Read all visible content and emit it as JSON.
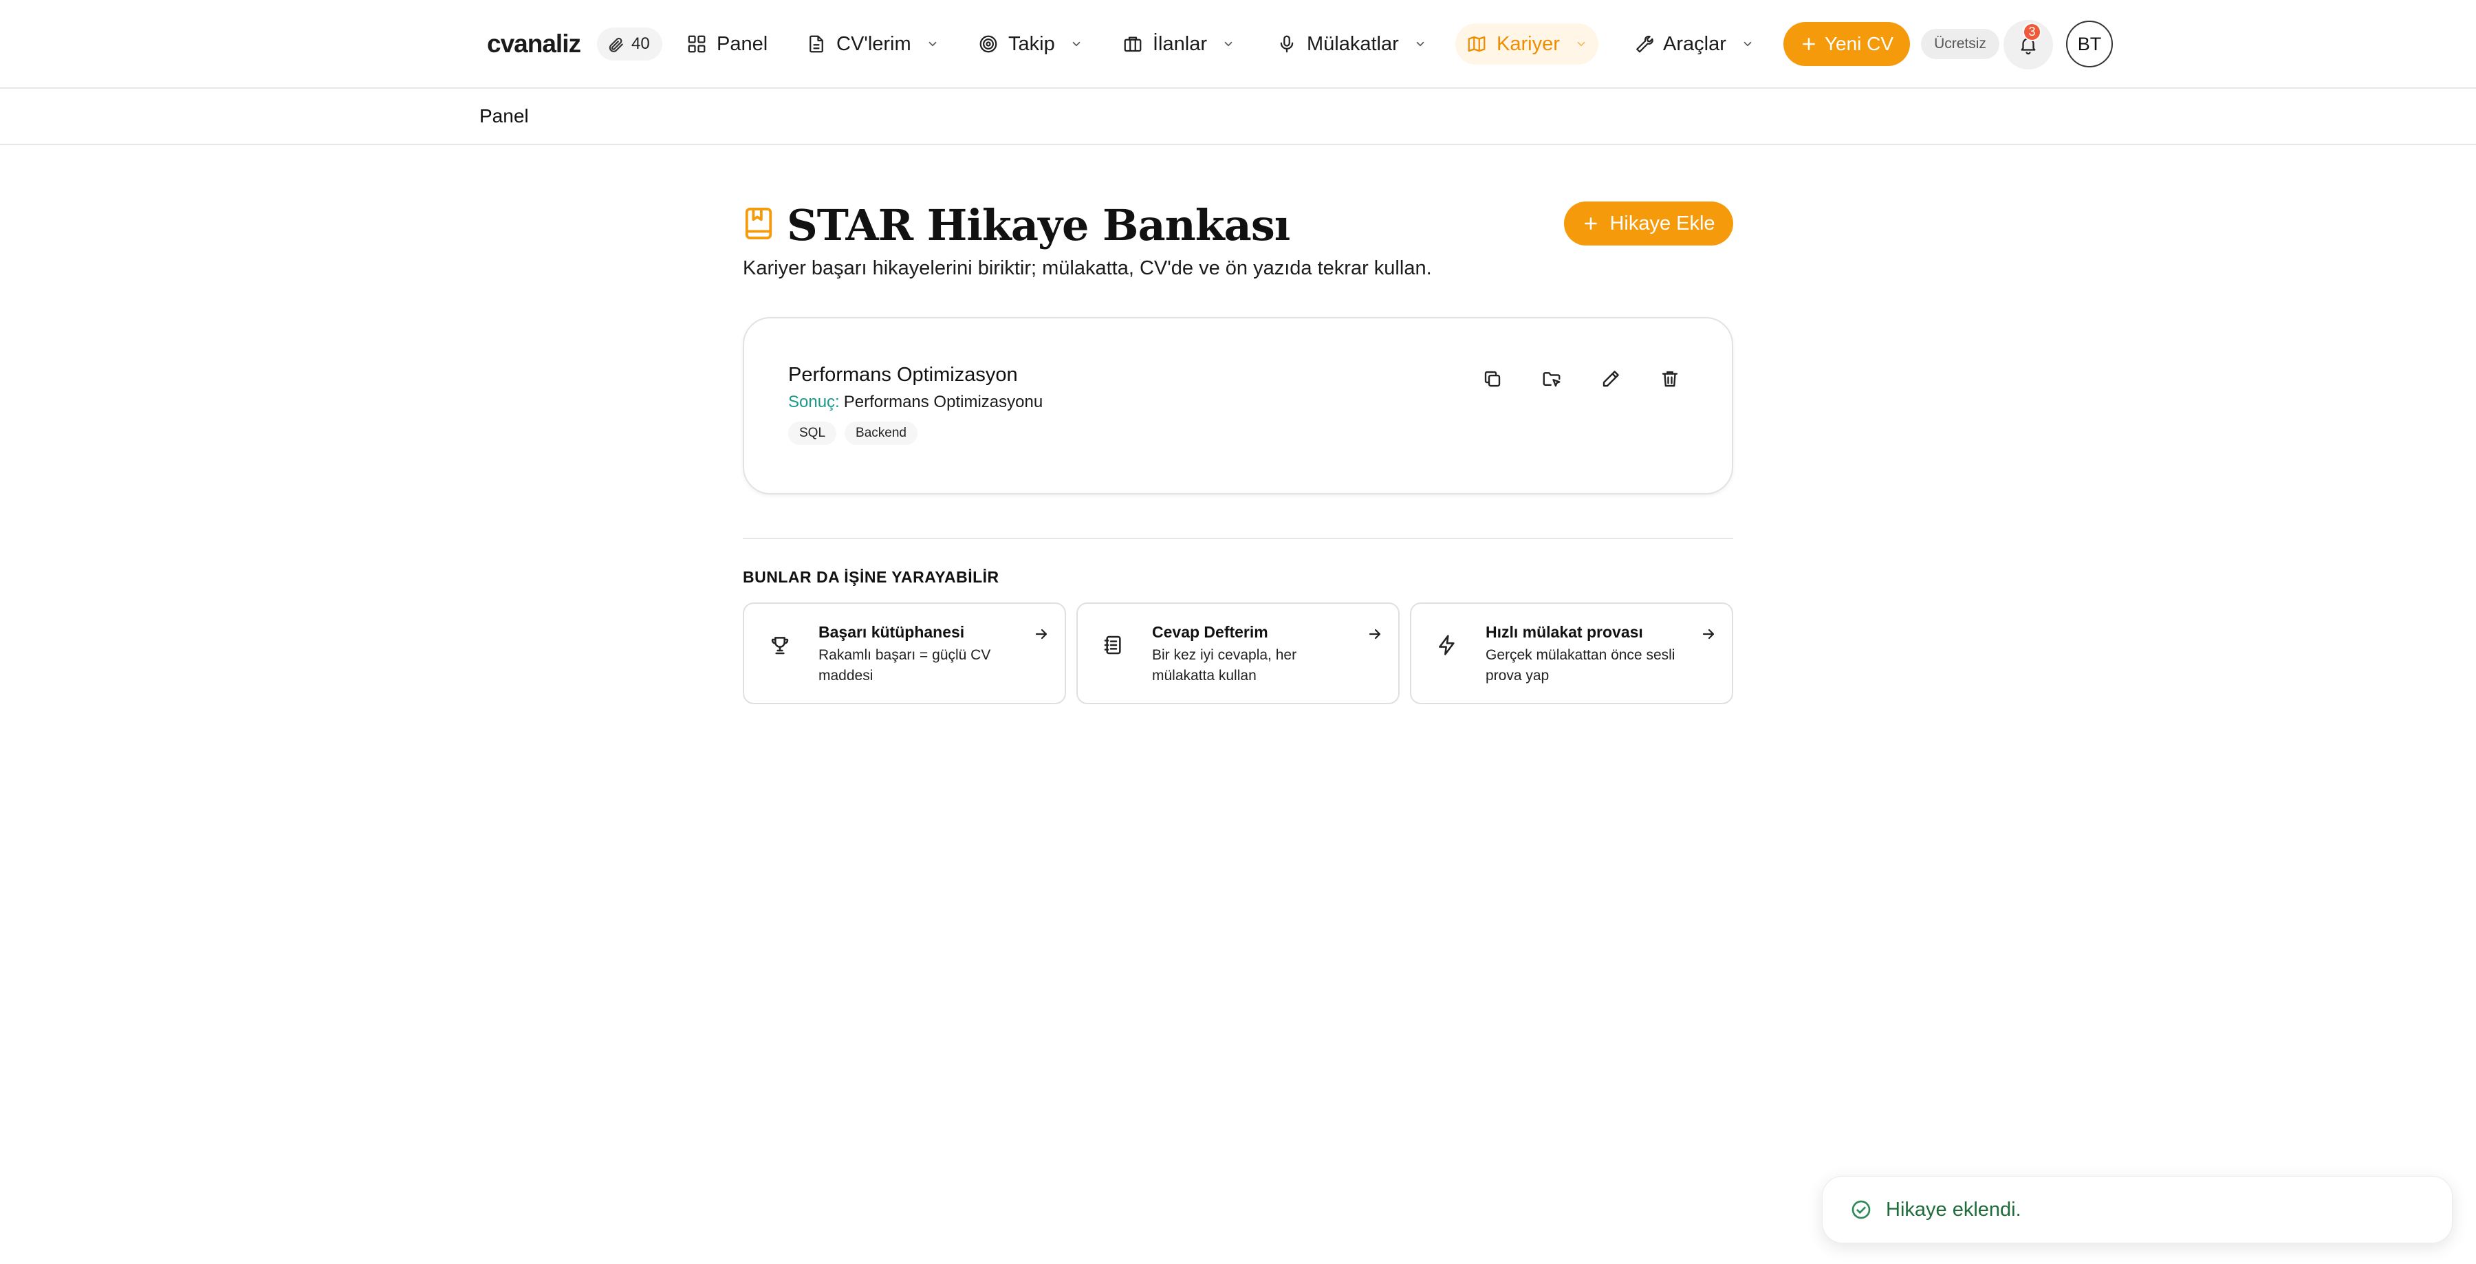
{
  "brand": {
    "logo_text": "cvanaliz"
  },
  "header": {
    "credits": "40",
    "nav": [
      {
        "label": "Panel",
        "icon": "grid-icon",
        "has_dropdown": false
      },
      {
        "label": "CV'lerim",
        "icon": "file-icon",
        "has_dropdown": true
      },
      {
        "label": "Takip",
        "icon": "target-icon",
        "has_dropdown": true
      },
      {
        "label": "İlanlar",
        "icon": "briefcase-icon",
        "has_dropdown": true
      },
      {
        "label": "Mülakatlar",
        "icon": "microphone-icon",
        "has_dropdown": true
      },
      {
        "label": "Kariyer",
        "icon": "map-icon",
        "has_dropdown": true,
        "active": true
      },
      {
        "label": "Araçlar",
        "icon": "wrench-icon",
        "has_dropdown": true
      }
    ],
    "new_cv_label": "Yeni CV",
    "plan_badge": "Ücretsiz",
    "notification_count": "3",
    "avatar_initials": "BT"
  },
  "breadcrumb": {
    "current": "Panel"
  },
  "page": {
    "title": "STAR Hikaye Bankası",
    "subtitle": "Kariyer başarı hikayelerini biriktir; mülakatta, CV'de ve ön yazıda tekrar kullan.",
    "add_button_label": "Hikaye Ekle"
  },
  "stories": [
    {
      "title": "Performans Optimizasyon",
      "result_label": "Sonuç:",
      "result_value": "Performans Optimizasyonu",
      "tags": [
        "SQL",
        "Backend"
      ],
      "actions": [
        "copy-icon",
        "folder-move-icon",
        "pencil-icon",
        "trash-icon"
      ]
    }
  ],
  "related": {
    "heading": "BUNLAR DA İŞİNE YARAYABİLİR",
    "items": [
      {
        "title": "Başarı kütüphanesi",
        "desc": "Rakamlı başarı = güçlü CV maddesi",
        "icon": "trophy-icon"
      },
      {
        "title": "Cevap Defterim",
        "desc": "Bir kez iyi cevapla, her mülakatta kullan",
        "icon": "notebook-icon"
      },
      {
        "title": "Hızlı mülakat provası",
        "desc": "Gerçek mülakattan önce sesli prova yap",
        "icon": "lightning-icon"
      }
    ]
  },
  "toast": {
    "message": "Hikaye eklendi."
  },
  "colors": {
    "accent": "#f59a0b",
    "active_nav_bg": "#fff6e8",
    "result_label": "#1a9a8a",
    "toast_text": "#1f6b3a",
    "notification": "#ef5b3a"
  }
}
